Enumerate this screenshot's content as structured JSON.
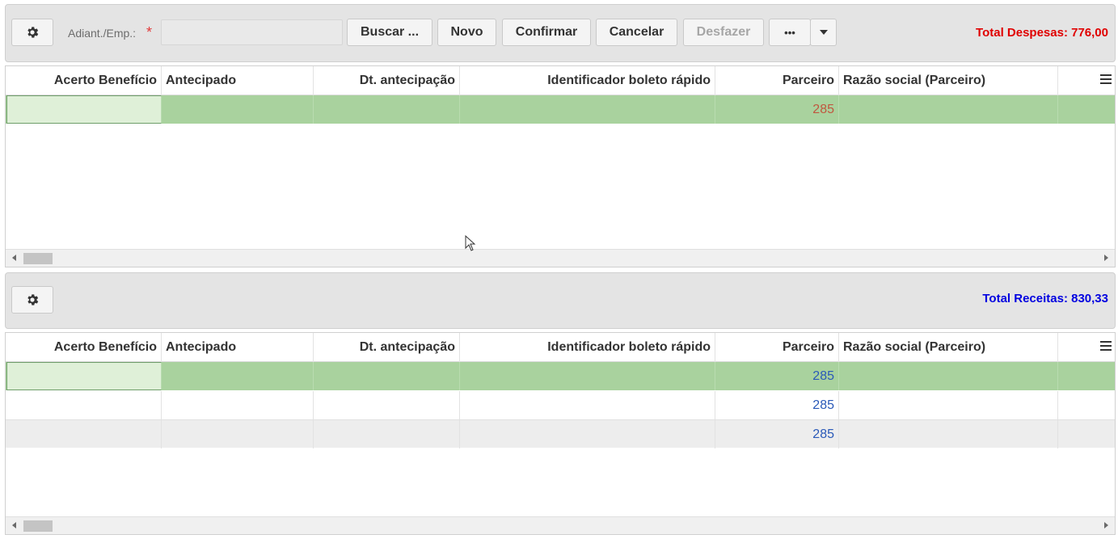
{
  "toolbar1": {
    "gear_icon": "gear-icon",
    "field_label": "Adiant./Emp.:",
    "required_mark": "*",
    "field_value": "",
    "buttons": {
      "buscar": "Buscar ...",
      "novo": "Novo",
      "confirmar": "Confirmar",
      "cancelar": "Cancelar",
      "desfazer": "Desfazer",
      "more": "•••"
    },
    "total": "Total Despesas: 776,00",
    "total_color": "#e00000"
  },
  "toolbar2": {
    "gear_icon": "gear-icon",
    "total": "Total Receitas: 830,33",
    "total_color": "#0000e0"
  },
  "columns": [
    "Acerto Benefício",
    "Antecipado",
    "Dt. antecipação",
    "Identificador boleto rápido",
    "Parceiro",
    "Razão social (Parceiro)"
  ],
  "grid1": {
    "rows": [
      {
        "parceiro": "285"
      }
    ]
  },
  "grid2": {
    "rows": [
      {
        "parceiro": "285"
      },
      {
        "parceiro": "285"
      },
      {
        "parceiro": "285"
      }
    ]
  },
  "colors": {
    "selected_row": "#a9d29e",
    "selected_cell": "#dff0d8",
    "expense_value": "#c0573f",
    "revenue_value": "#2a59b8"
  }
}
